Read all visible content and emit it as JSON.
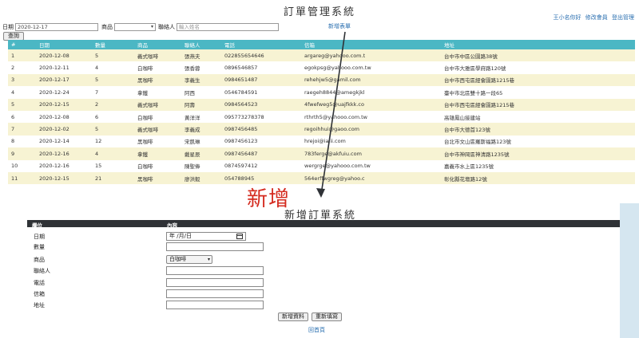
{
  "header": {
    "title": "訂單管理系統",
    "user_links": [
      "王小名你好",
      "修改會員",
      "登出管理"
    ]
  },
  "filter": {
    "date_label": "日期",
    "date_value": "2020-12-17",
    "product_label": "商品",
    "product_value": "",
    "contact_label": "聯絡人",
    "contact_placeholder": "輸入姓名",
    "add_link": "新增表單",
    "query_button": "查詢"
  },
  "table": {
    "columns": [
      "#",
      "日期",
      "數量",
      "商品",
      "聯絡人",
      "電話",
      "信箱",
      "地址"
    ],
    "rows": [
      [
        "1",
        "2020-12-08",
        "5",
        "義式咖啡",
        "張燕夫",
        "022855654646",
        "argareg@yahooo.com.t",
        "台中市中區公園路38號"
      ],
      [
        "2",
        "2020-12-11",
        "4",
        "白咖啡",
        "張香蓉",
        "0896546857",
        "egokpsg@yahooo.com.tw",
        "台中市大雅區學府路120號"
      ],
      [
        "3",
        "2020-12-17",
        "5",
        "黑咖啡",
        "李義生",
        "0984651487",
        "rehehjw5@gamil.com",
        "台中市西屯區經會園路1215巷"
      ],
      [
        "4",
        "2020-12-24",
        "7",
        "拿鐵",
        "阿西",
        "0546784591",
        "raegeh8844@amegkjkl",
        "臺中市北區雙十路一段65"
      ],
      [
        "5",
        "2020-12-15",
        "2",
        "義式咖啡",
        "阿壽",
        "0984564523",
        "4fwefweg5@uajfkkk.co",
        "台中市西屯區經會園路1215巷"
      ],
      [
        "6",
        "2020-12-08",
        "6",
        "白咖啡",
        "黃洋洋",
        "095773278378",
        "rthrth5@yahooo.com.tw",
        "高雄鳳山接建站"
      ],
      [
        "7",
        "2020-12-02",
        "5",
        "義式咖啡",
        "李義成",
        "0987456485",
        "regoihhui@gaoo.com",
        "台中市大德首123號"
      ],
      [
        "8",
        "2020-12-14",
        "12",
        "黑咖啡",
        "宋凱琳",
        "0987456123",
        "hrejoi@iaiii.com",
        "台北市文山區羅斯福路123號"
      ],
      [
        "9",
        "2020-12-16",
        "4",
        "拿鐵",
        "戴星辰",
        "0987456487",
        "783ferge@akfuiu.com",
        "台中市神岡區神清路1235號"
      ],
      [
        "10",
        "2020-12-16",
        "15",
        "白咖啡",
        "陳聖俸",
        "0874597412",
        "wergrge@yahooo.com.tw",
        "嘉義市水上區1235號"
      ],
      [
        "11",
        "2020-12-15",
        "21",
        "黑咖啡",
        "廖洪毅",
        "054788945",
        "564erffwgreg@yahoo.c",
        "彰化縣花壇路12號"
      ]
    ]
  },
  "annotation": {
    "text": "新增",
    "color": "#d42a1e"
  },
  "form": {
    "title": "新增訂單系統",
    "head_field": "欄位",
    "head_content": "內容",
    "date_label": "日期",
    "date_value": "年 /月/日",
    "qty_label": "數量",
    "product_label": "商品",
    "product_value": "白咖啡",
    "contact_label": "聯絡人",
    "phone_label": "電話",
    "email_label": "信箱",
    "address_label": "地址",
    "submit_button": "新增資料",
    "reset_button": "重新填寫",
    "back_link": "回首頁"
  },
  "colors": {
    "table_header": "#4bb7c4",
    "row_stripe": "#f7f3d3",
    "link": "#2a6fb0"
  }
}
